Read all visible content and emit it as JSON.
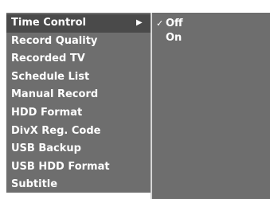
{
  "menu": {
    "items": [
      {
        "label": "Time Control",
        "selected": true
      },
      {
        "label": "Record Quality"
      },
      {
        "label": "Recorded TV"
      },
      {
        "label": "Schedule List"
      },
      {
        "label": "Manual Record"
      },
      {
        "label": "HDD Format"
      },
      {
        "label": "DivX Reg. Code"
      },
      {
        "label": "USB Backup"
      },
      {
        "label": "USB HDD Format"
      },
      {
        "label": "Subtitle"
      }
    ],
    "submenu_arrow": "▶"
  },
  "submenu": {
    "options": [
      {
        "label": "Off",
        "checked": true,
        "check_mark": "✓"
      },
      {
        "label": "On",
        "checked": false
      }
    ]
  },
  "colors": {
    "panel": "#6e6e6e",
    "selected": "#4a4a4a",
    "divider": "#d6d6d6",
    "text": "#ffffff"
  }
}
